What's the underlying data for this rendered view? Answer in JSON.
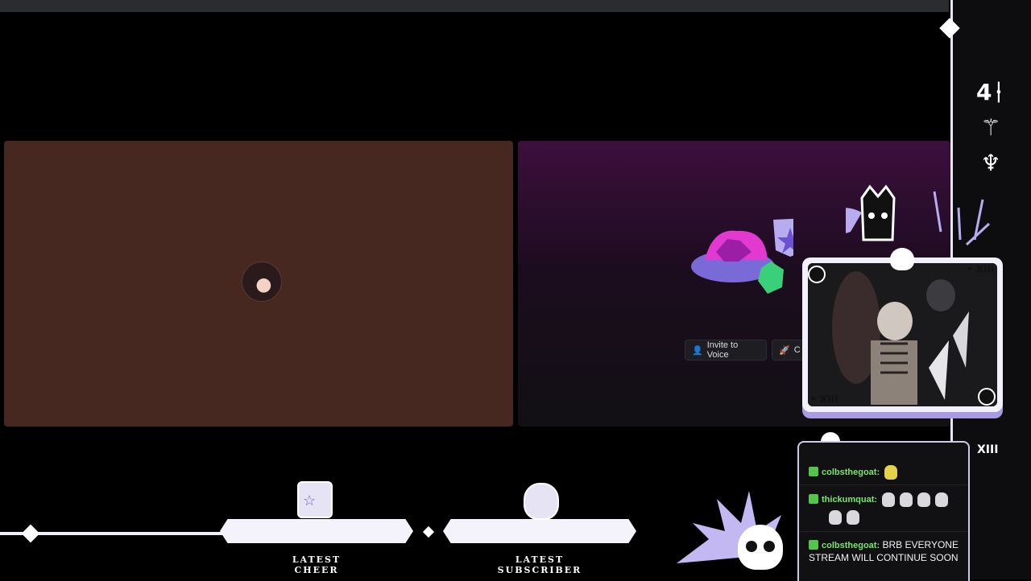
{
  "video_tiles": {
    "left": {
      "background": "#472820",
      "avatar": "user-avatar"
    },
    "right": {
      "background_top": "#3c0f3d"
    }
  },
  "voice_actions": {
    "invite_label": "Invite to Voice",
    "clip_label": "C"
  },
  "overlay": {
    "webcam": {
      "tag_top": "• XIII",
      "tag_bottom": "• XIII"
    },
    "rail_runes": [
      "4ᚽ",
      "⚚",
      "♆"
    ],
    "chat_corner_label": "XIII"
  },
  "chat": {
    "messages": [
      {
        "user": "colbsthegoat:",
        "text": "",
        "emotes": [
          "yellow-blob"
        ]
      },
      {
        "user": "thickumquat:",
        "text": "",
        "emotes": [
          "skull",
          "skull",
          "skull",
          "skull",
          "skull",
          "skull"
        ]
      },
      {
        "user": "colbsthegoat:",
        "text": "BRB EVERYONE STREAM WILL CONTINUE SOON",
        "emotes": []
      }
    ],
    "user_color": "#7be36f"
  },
  "alerts": {
    "latest_cheer": "LATEST CHEER",
    "latest_subscriber": "LATEST SUBSCRIBER"
  },
  "colors": {
    "accent": "#a99be0",
    "frame": "#f2f0fa",
    "topbar": "#2a2c30"
  }
}
